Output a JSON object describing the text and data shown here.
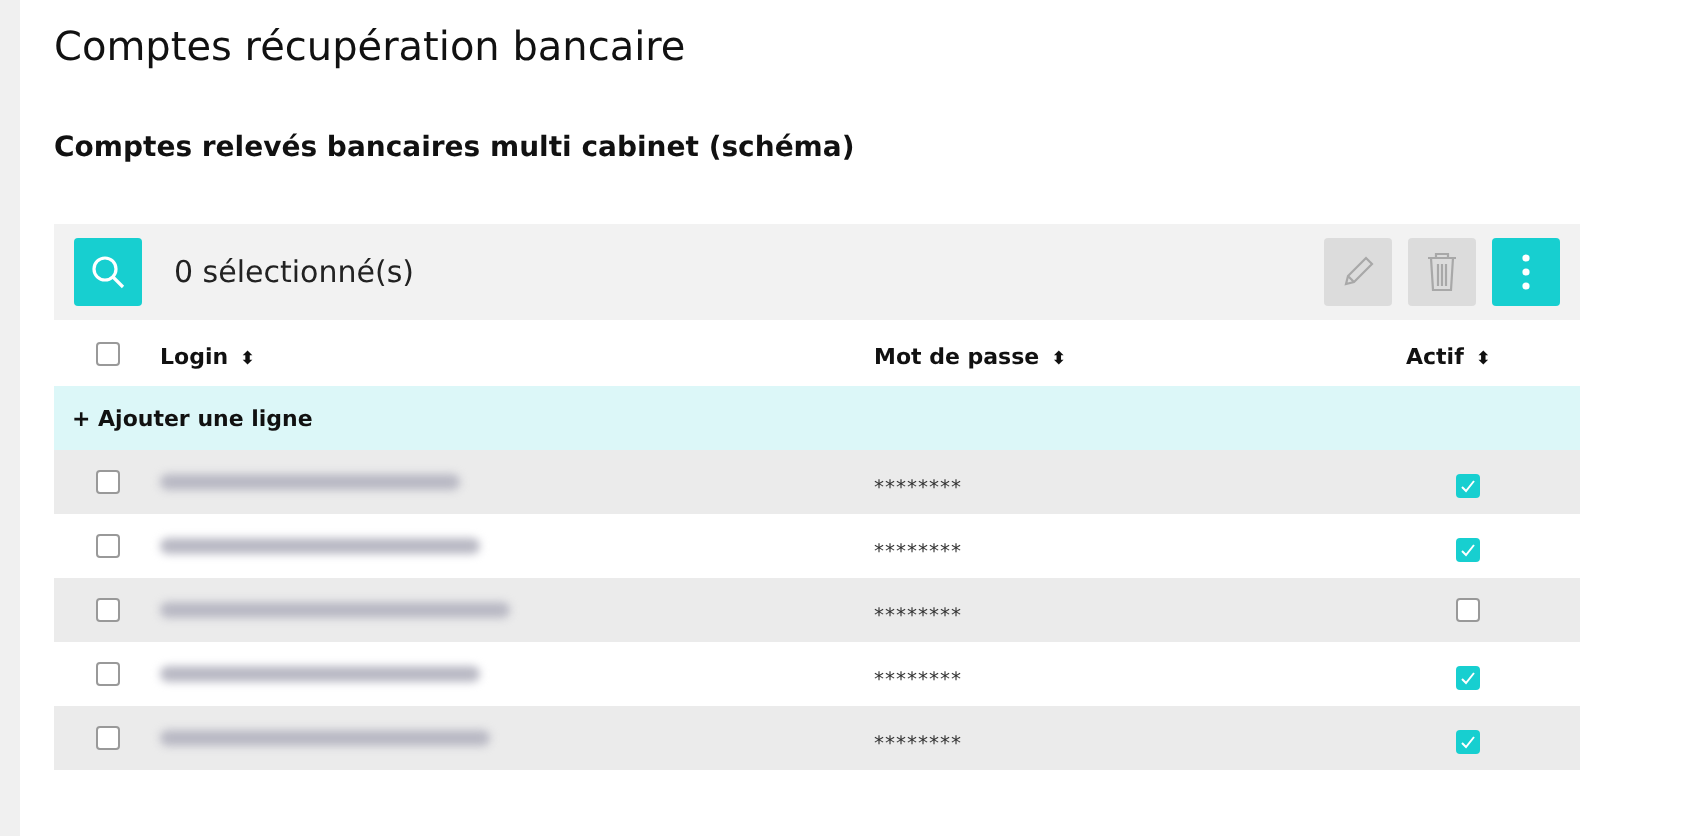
{
  "page_title": "Comptes récupération bancaire",
  "section_title": "Comptes relevés bancaires multi cabinet (schéma)",
  "toolbar": {
    "selection_count": "0 sélectionné(s)",
    "edit_disabled": true,
    "delete_disabled": true
  },
  "table": {
    "select_all_checked": false,
    "columns": [
      {
        "label": "Login",
        "sort_icon": "⬍"
      },
      {
        "label": "Mot de passe",
        "sort_icon": "⬍"
      },
      {
        "label": "Actif",
        "sort_icon": "⬍"
      }
    ],
    "add_row": "+ Ajouter une ligne",
    "rows": [
      {
        "selected": false,
        "password": "********",
        "active": true
      },
      {
        "selected": false,
        "password": "********",
        "active": true
      },
      {
        "selected": false,
        "password": "********",
        "active": false
      },
      {
        "selected": false,
        "password": "********",
        "active": true
      },
      {
        "selected": false,
        "password": "********",
        "active": true
      }
    ]
  }
}
